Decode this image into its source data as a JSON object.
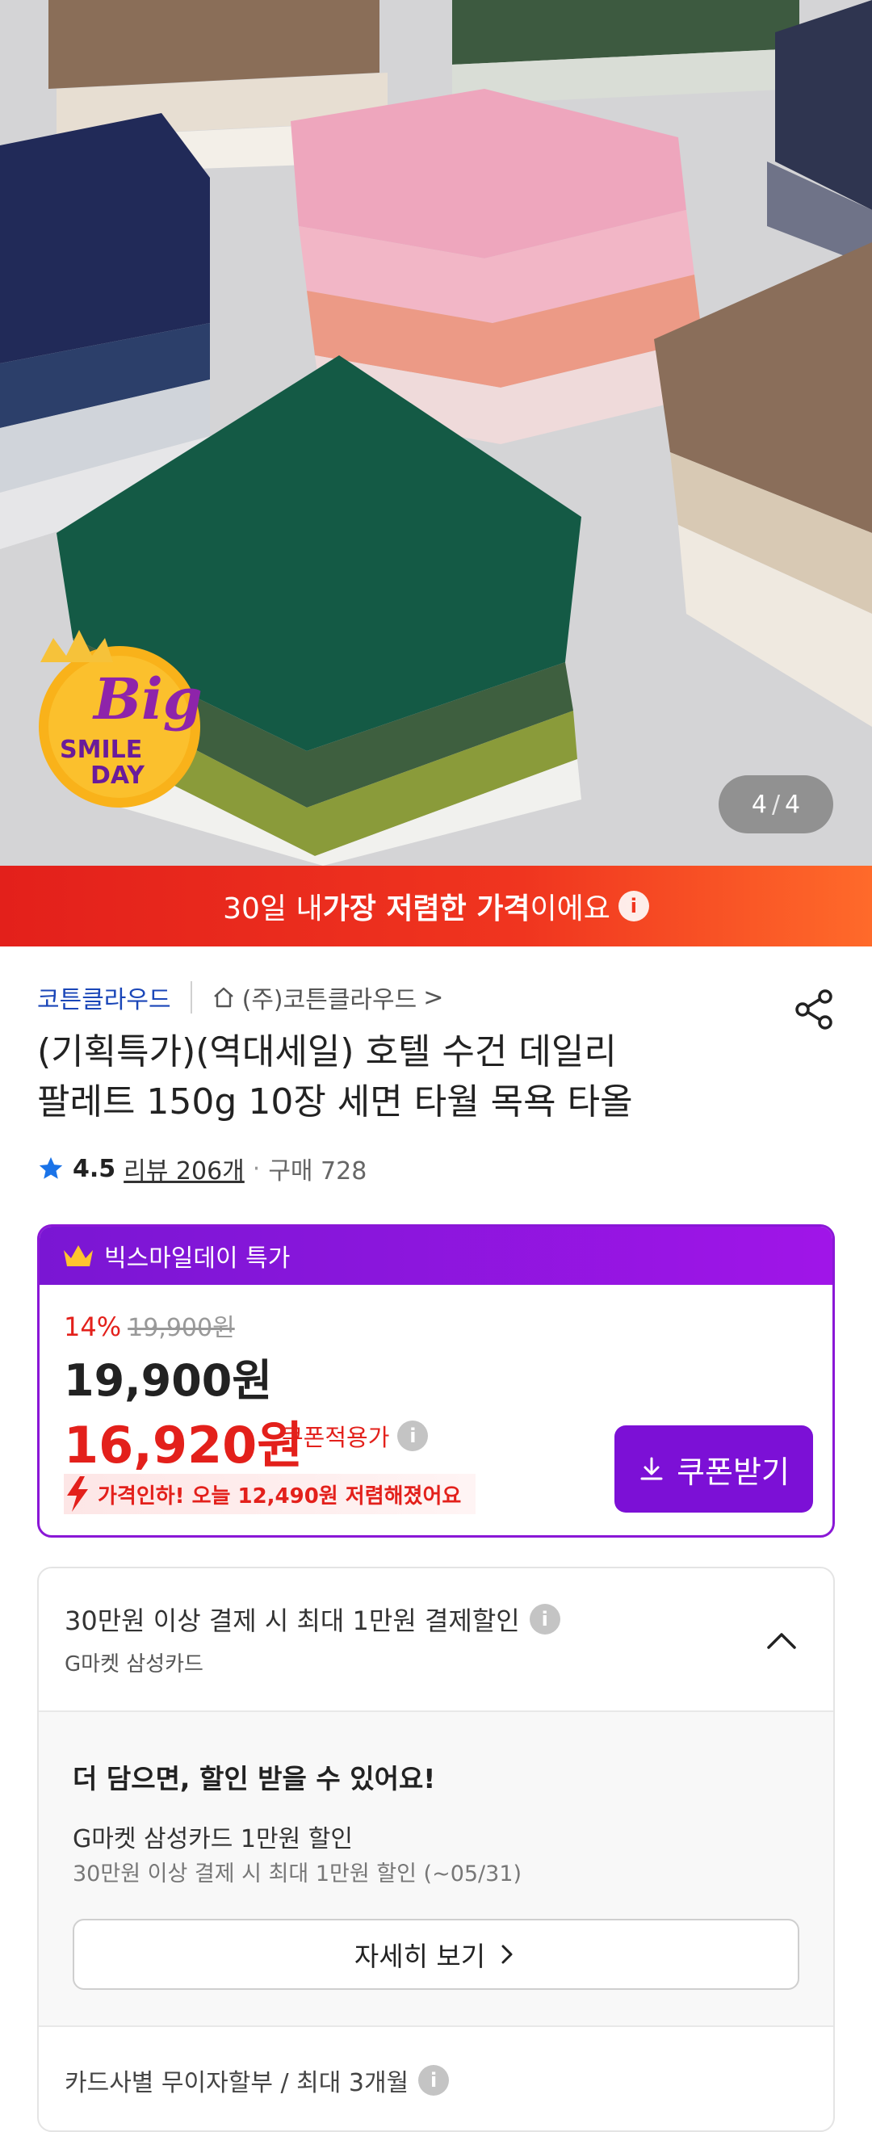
{
  "gallery": {
    "current": "4",
    "separator": "/",
    "total": "4",
    "badge": {
      "line1": "Big",
      "line2": "SMILE",
      "line3": "DAY"
    }
  },
  "banner": {
    "pre": "30일 내 ",
    "bold": "가장 저렴한 가격",
    "post": "이에요",
    "info": "i"
  },
  "seller": {
    "brand": "코튼클라우드",
    "shop": "(주)코튼클라우드",
    "chevron": ">"
  },
  "product": {
    "title_line1": "(기획특가)(역대세일) 호텔 수건 데일리",
    "title_line2": "팔레트 150g 10장 세면 타월 목욕 타올",
    "rating": "4.5",
    "reviews": "리뷰 206개",
    "dot": "·",
    "purchases": "구매 728"
  },
  "deal": {
    "header": "빅스마일데이 특가",
    "discount_rate": "14%",
    "original_price": "19,900원",
    "price": "19,900원",
    "sale_price": "16,920원",
    "coupon_label": "쿠폰적용가",
    "price_drop": "가격인하! 오늘 12,490원 저렴해졌어요",
    "coupon_button": "쿠폰받기"
  },
  "card_discount": {
    "title": "30만원 이상 결제 시 최대 1만원 결제할인",
    "card_name": "G마켓 삼성카드",
    "more_title": "더 담으면, 할인 받을 수 있어요!",
    "benefit": "G마켓 삼성카드 1만원 할인",
    "benefit_sub": "30만원 이상 결제 시 최대 1만원 할인 (~05/31)",
    "detail_button": "자세히 보기",
    "installment": "카드사별 무이자할부 / 최대 3개월"
  },
  "colors": {
    "brand_red": "#e3201b",
    "deal_purple": "#7c10d6",
    "link_blue": "#1a46b8"
  }
}
